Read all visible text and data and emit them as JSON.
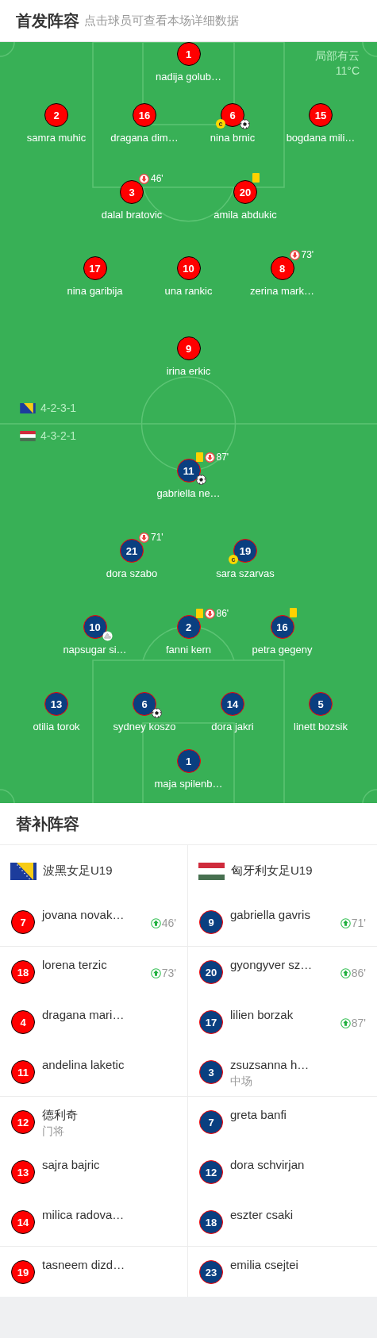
{
  "header": {
    "title": "首发阵容",
    "subtitle": "点击球员可查看本场详细数据"
  },
  "lineup": {
    "weather": "局部有云",
    "temperature": "11°C",
    "teams": [
      {
        "kind": "bih",
        "formation": "4-2-3-1",
        "color": "#ff0000",
        "lines": [
          [
            {
              "number": "1",
              "name": "nadija golub…"
            }
          ],
          [
            {
              "number": "2",
              "name": "samra muhic"
            },
            {
              "number": "16",
              "name": "dragana dim…"
            },
            {
              "number": "6",
              "name": "nina brnic",
              "events": [
                {
                  "kind": "captain",
                  "text": "c"
                },
                {
                  "kind": "goal"
                }
              ]
            },
            {
              "number": "15",
              "name": "bogdana mili…"
            }
          ],
          [
            {
              "number": "3",
              "name": "dalal bratovic",
              "events": [
                {
                  "kind": "sub_off",
                  "minute": "46'"
                }
              ]
            },
            {
              "number": "20",
              "name": "amila abdukic",
              "events": [
                {
                  "kind": "yellow_card"
                }
              ]
            }
          ],
          [
            {
              "number": "17",
              "name": "nina garibija"
            },
            {
              "number": "10",
              "name": "una rankic"
            },
            {
              "number": "8",
              "name": "zerina mark…",
              "events": [
                {
                  "kind": "sub_off",
                  "minute": "73'"
                }
              ]
            }
          ],
          [
            {
              "number": "9",
              "name": "irina erkic"
            }
          ]
        ]
      },
      {
        "kind": "hun",
        "formation": "4-3-2-1",
        "color": "#0a3f80",
        "lines": [
          [
            {
              "number": "11",
              "name": "gabriella ne…",
              "events": [
                {
                  "kind": "yellow_card"
                },
                {
                  "kind": "sub_off",
                  "minute": "87'"
                },
                {
                  "kind": "goal"
                }
              ]
            }
          ],
          [
            {
              "number": "21",
              "name": "dora szabo",
              "events": [
                {
                  "kind": "sub_off",
                  "minute": "71'"
                }
              ]
            },
            {
              "number": "19",
              "name": "sara szarvas",
              "events": [
                {
                  "kind": "captain",
                  "text": "c"
                }
              ]
            }
          ],
          [
            {
              "number": "10",
              "name": "napsugar si…",
              "events": [
                {
                  "kind": "assist"
                }
              ]
            },
            {
              "number": "2",
              "name": "fanni kern",
              "events": [
                {
                  "kind": "yellow_card"
                },
                {
                  "kind": "sub_off",
                  "minute": "86'"
                }
              ]
            },
            {
              "number": "16",
              "name": "petra gegeny",
              "events": [
                {
                  "kind": "yellow_card"
                }
              ]
            }
          ],
          [
            {
              "number": "13",
              "name": "otilia torok"
            },
            {
              "number": "6",
              "name": "sydney koszo",
              "events": [
                {
                  "kind": "goal"
                }
              ]
            },
            {
              "number": "14",
              "name": "dora jakri"
            },
            {
              "number": "5",
              "name": "linett bozsik"
            }
          ],
          [
            {
              "number": "1",
              "name": "maja spilenb…"
            }
          ]
        ]
      }
    ]
  },
  "substitutes": {
    "title": "替补阵容",
    "teams": [
      {
        "kind": "bih",
        "name": "波黑女足U19",
        "color": "#ff0000",
        "players": [
          {
            "number": "7",
            "name": "jovana novak…",
            "sub_on": "46'"
          },
          {
            "number": "18",
            "name": "lorena terzic",
            "sub_on": "73'"
          },
          {
            "number": "4",
            "name": "dragana mari…"
          },
          {
            "number": "11",
            "name": "andelina laketic"
          },
          {
            "number": "12",
            "name": "德利奇",
            "position": "门将"
          },
          {
            "number": "13",
            "name": "sajra bajric"
          },
          {
            "number": "14",
            "name": "milica radova…"
          },
          {
            "number": "19",
            "name": "tasneem dizd…"
          }
        ]
      },
      {
        "kind": "hun",
        "name": "匈牙利女足U19",
        "color": "#0a3f80",
        "players": [
          {
            "number": "9",
            "name": "gabriella gavris",
            "sub_on": "71'"
          },
          {
            "number": "20",
            "name": "gyongyver sz…",
            "sub_on": "86'"
          },
          {
            "number": "17",
            "name": "lilien borzak",
            "sub_on": "87'"
          },
          {
            "number": "3",
            "name": "zsuzsanna h…",
            "position": "中场"
          },
          {
            "number": "7",
            "name": "greta banfi"
          },
          {
            "number": "12",
            "name": "dora schvirjan"
          },
          {
            "number": "18",
            "name": "eszter csaki"
          },
          {
            "number": "23",
            "name": "emilia csejtei"
          }
        ]
      }
    ]
  }
}
